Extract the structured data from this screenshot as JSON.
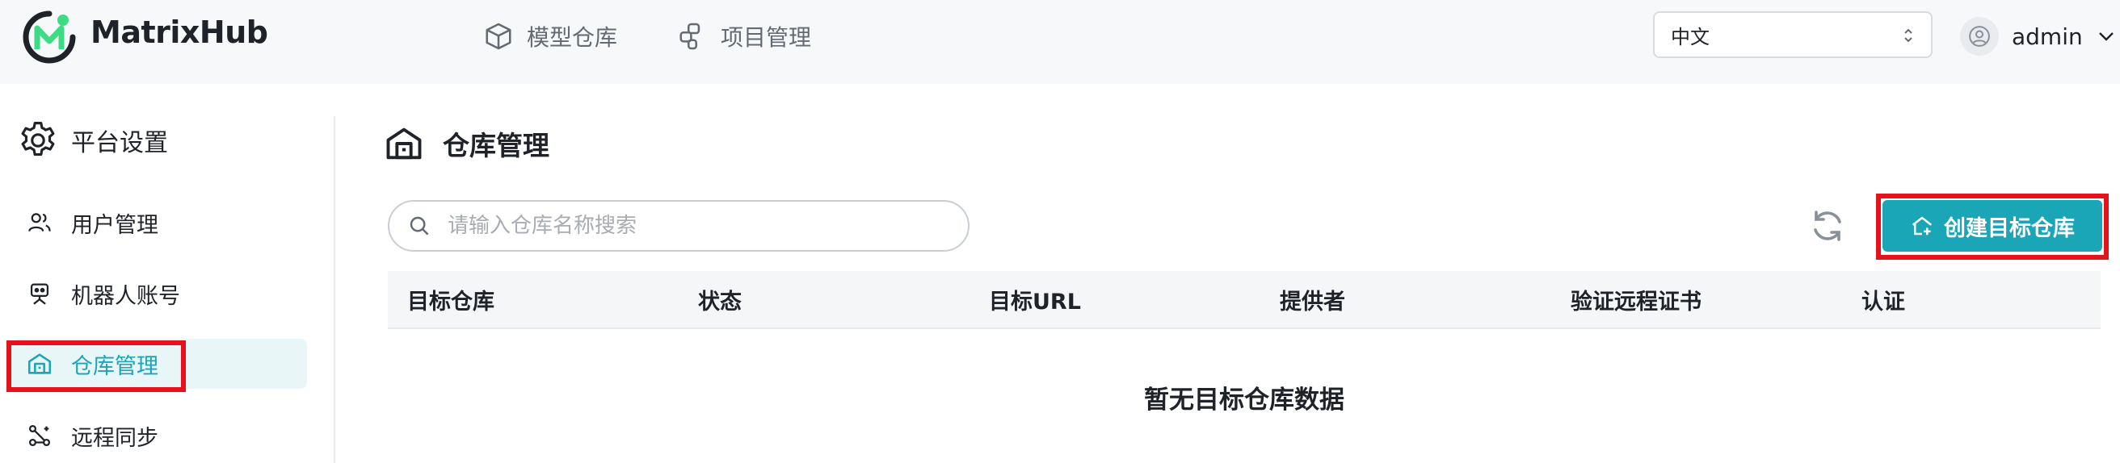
{
  "app": {
    "name": "MatrixHub"
  },
  "header": {
    "nav": [
      {
        "label": "模型仓库",
        "icon": "cube-icon"
      },
      {
        "label": "项目管理",
        "icon": "project-icon"
      }
    ],
    "language": {
      "selected": "中文"
    },
    "user": {
      "name": "admin"
    }
  },
  "sidebar": {
    "title": "平台设置",
    "items": [
      {
        "label": "用户管理",
        "icon": "users-icon"
      },
      {
        "label": "机器人账号",
        "icon": "robot-icon"
      },
      {
        "label": "仓库管理",
        "icon": "warehouse-icon",
        "active": true
      },
      {
        "label": "远程同步",
        "icon": "sync-nodes-icon"
      }
    ]
  },
  "main": {
    "title": "仓库管理",
    "search": {
      "placeholder": "请输入仓库名称搜索",
      "value": ""
    },
    "create_button": "创建目标仓库",
    "table": {
      "columns": [
        "目标仓库",
        "状态",
        "目标URL",
        "提供者",
        "验证远程证书",
        "认证"
      ],
      "rows": [],
      "empty_text": "暂无目标仓库数据"
    }
  },
  "colors": {
    "accent": "#1aa6b7",
    "highlight": "#e5121b",
    "logo_green": "#3ddc84"
  }
}
